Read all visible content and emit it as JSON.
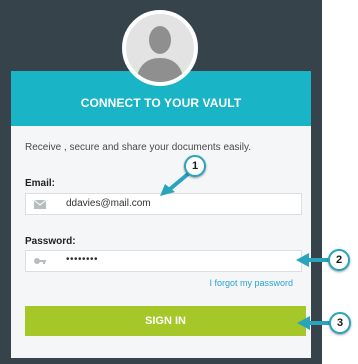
{
  "card": {
    "title": "CONNECT TO YOUR VAULT",
    "subtitle": "Receive , secure and share your documents easily."
  },
  "email": {
    "label": "Email:",
    "value": "ddavies@mail.com",
    "icon": "envelope-icon"
  },
  "password": {
    "label": "Password:",
    "value": "••••••••",
    "icon": "key-icon"
  },
  "forgot_link": "I forgot my password",
  "signin_label": "SIGN IN",
  "callouts": [
    "1",
    "2",
    "3"
  ],
  "colors": {
    "header": "#19b5c6",
    "signin": "#a5c828",
    "frame": "#36434a",
    "link": "#2aa3d6",
    "callout_border": "#2aa4bd"
  }
}
